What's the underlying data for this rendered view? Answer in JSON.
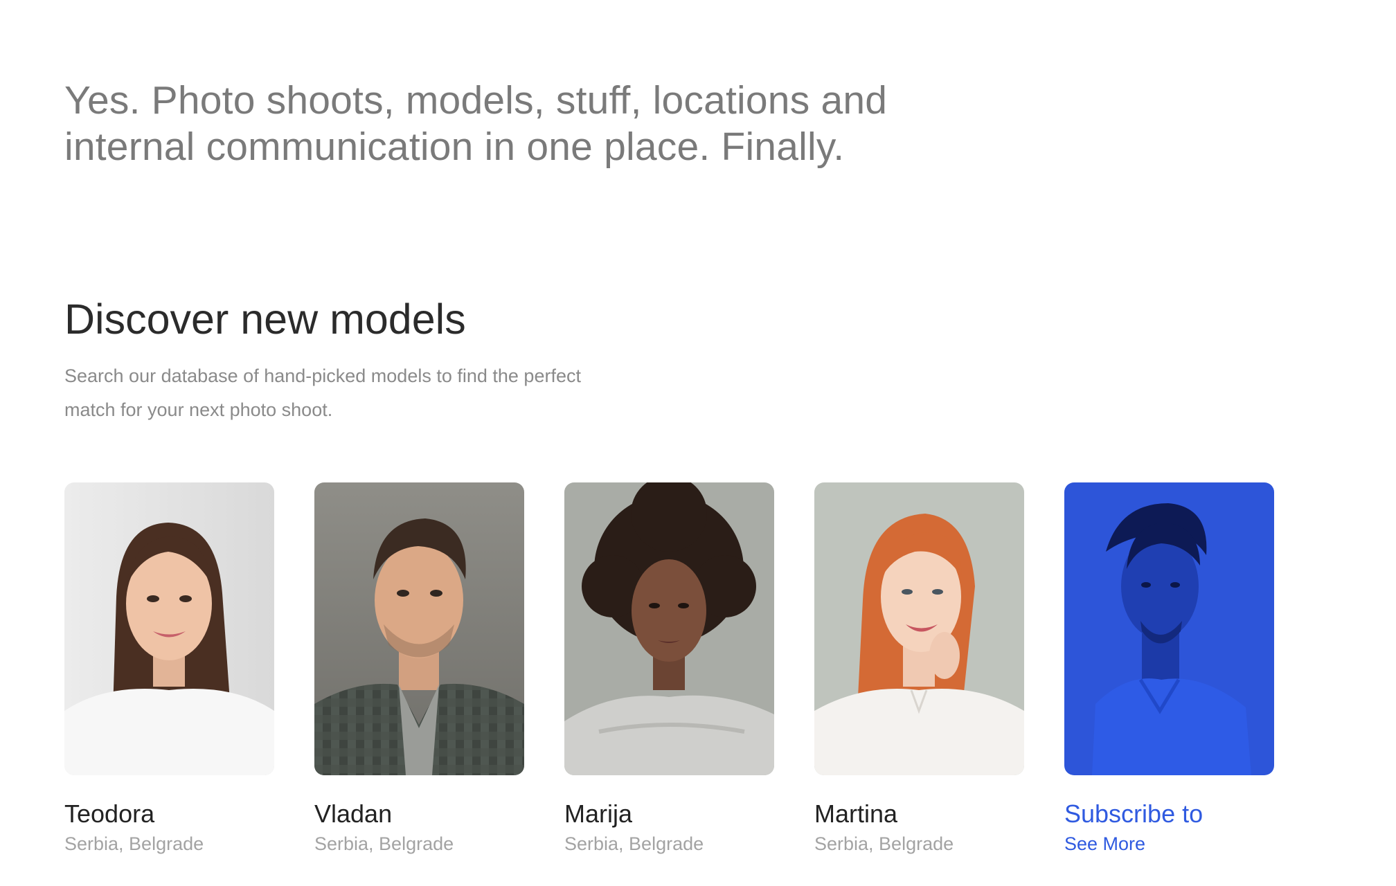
{
  "hero": {
    "tagline": "Yes. Photo shoots, models, stuff, locations and internal communication in one place. Finally."
  },
  "discover": {
    "title": "Discover new models",
    "description": "Search our database of hand-picked models to find the perfect match for your next photo shoot."
  },
  "models": [
    {
      "name": "Teodora",
      "location": "Serbia, Belgrade",
      "photo": "portrait-woman-brown-hair"
    },
    {
      "name": "Vladan",
      "location": "Serbia, Belgrade",
      "photo": "portrait-man-checked-shirt"
    },
    {
      "name": "Marija",
      "location": "Serbia, Belgrade",
      "photo": "portrait-woman-curly-hair"
    },
    {
      "name": "Martina",
      "location": "Serbia, Belgrade",
      "photo": "portrait-woman-red-hair"
    }
  ],
  "subscribe_card": {
    "title": "Subscribe to",
    "link": "See More",
    "photo": "portrait-man-blue-overlay"
  },
  "colors": {
    "accent": "#2f5ae0",
    "tagline": "#7a7a7a",
    "heading": "#2b2b2b",
    "muted": "#a3a3a3"
  }
}
